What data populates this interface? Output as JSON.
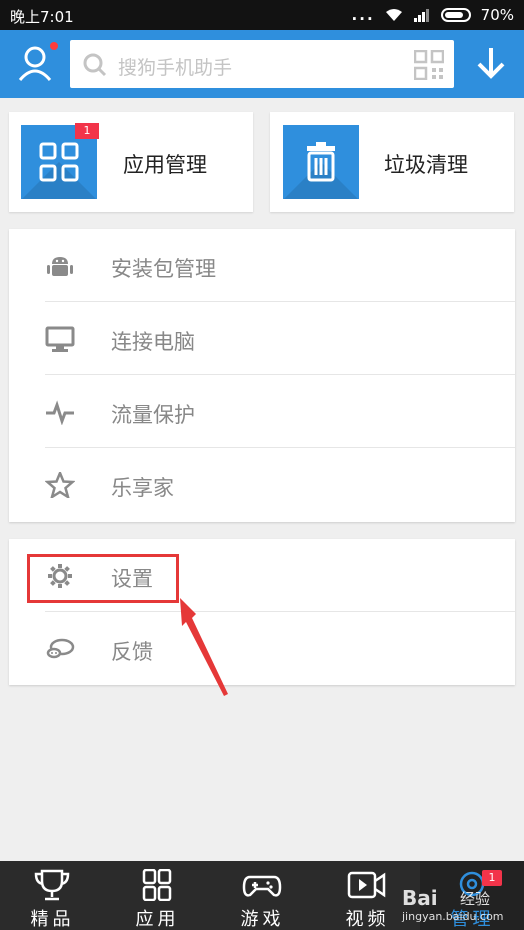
{
  "status_bar": {
    "time": "晚上7:01",
    "dots": "...",
    "battery": "70%"
  },
  "header": {
    "search_placeholder": "搜狗手机助手"
  },
  "cards": [
    {
      "label": "应用管理",
      "badge": "1",
      "icon": "apps-grid-icon"
    },
    {
      "label": "垃圾清理",
      "icon": "trash-icon"
    }
  ],
  "list_main": [
    {
      "label": "安装包管理",
      "icon": "android-icon"
    },
    {
      "label": "连接电脑",
      "icon": "monitor-icon"
    },
    {
      "label": "流量保护",
      "icon": "pulse-icon"
    },
    {
      "label": "乐享家",
      "icon": "star-icon"
    }
  ],
  "list_extra": [
    {
      "label": "设置",
      "icon": "gear-icon"
    },
    {
      "label": "反馈",
      "icon": "feedback-icon"
    }
  ],
  "bottom_nav": [
    {
      "label": "精品",
      "icon": "trophy-icon"
    },
    {
      "label": "应用",
      "icon": "apps-icon"
    },
    {
      "label": "游戏",
      "icon": "gamepad-icon"
    },
    {
      "label": "视频",
      "icon": "video-icon"
    },
    {
      "label": "管理",
      "icon": "manage-icon",
      "badge": "1",
      "active": true
    }
  ],
  "watermark": {
    "brand": "Bai",
    "sub": "经验",
    "url": "jingyan.baidu.com"
  },
  "colors": {
    "accent": "#2f8fdd",
    "badge": "#f2344a",
    "highlight": "#e53838"
  }
}
